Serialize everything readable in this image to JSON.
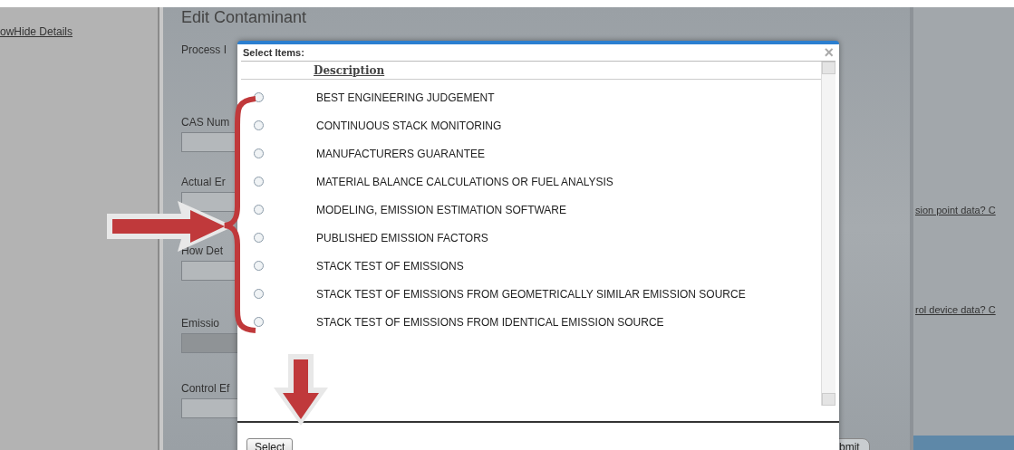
{
  "sidebar": {
    "link": "owHide Details"
  },
  "form": {
    "title": "Edit Contaminant",
    "fields": [
      {
        "label": "Process I",
        "kind": "none"
      },
      {
        "label": "CAS Num",
        "kind": "input"
      },
      {
        "label": "Actual Er",
        "kind": "input"
      },
      {
        "label": "How Det",
        "kind": "input"
      },
      {
        "label": "Emissio",
        "kind": "disabled"
      },
      {
        "label": "Control Ef",
        "kind": "input"
      }
    ],
    "links": [
      "sion point data? C",
      "rol device data? C"
    ],
    "submit": "bmit"
  },
  "dialog": {
    "title": "Select Items:",
    "close": "×",
    "column": "Description",
    "items": [
      {
        "label": "BEST ENGINEERING JUDGEMENT",
        "selected": false
      },
      {
        "label": "CONTINUOUS STACK MONITORING",
        "selected": false
      },
      {
        "label": "MANUFACTURERS GUARANTEE",
        "selected": false
      },
      {
        "label": "MATERIAL BALANCE CALCULATIONS OR FUEL ANALYSIS",
        "selected": false
      },
      {
        "label": "MODELING, EMISSION ESTIMATION SOFTWARE",
        "selected": false
      },
      {
        "label": "PUBLISHED EMISSION FACTORS",
        "selected": false
      },
      {
        "label": "STACK TEST OF EMISSIONS",
        "selected": false
      },
      {
        "label": "STACK TEST OF EMISSIONS FROM GEOMETRICALLY SIMILAR EMISSION SOURCE",
        "selected": false
      },
      {
        "label": "STACK TEST OF EMISSIONS FROM IDENTICAL EMISSION SOURCE",
        "selected": false
      }
    ],
    "button": "Select"
  }
}
